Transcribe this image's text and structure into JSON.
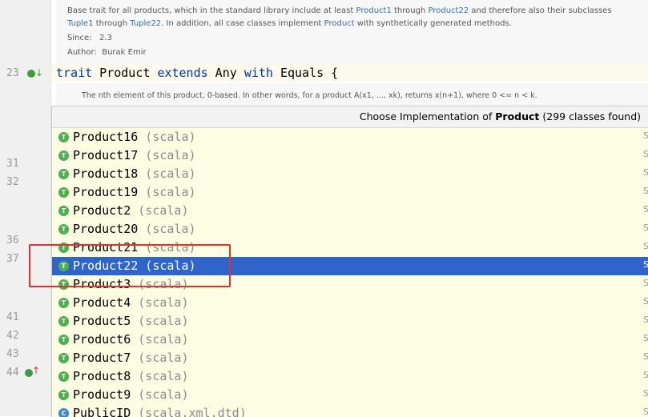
{
  "colors": {
    "accent": "#2f65ca",
    "highlight": "#e8302a",
    "trait_icon": "#4caf50",
    "class_icon": "#3d88d6"
  },
  "doc_top": {
    "line1_a": "Base trait for all products, which in the standard library include at least ",
    "line1_code1": "Product1",
    "line1_b": " through ",
    "line1_code2": "Product22",
    "line1_c": " and therefore also their subclasses",
    "line2_code1": "Tuple1",
    "line2_b": " through ",
    "line2_code2": "Tuple22",
    "line2_c": ". In addition, all case classes implement ",
    "line2_code3": "Product",
    "line2_d": " with synthetically generated methods.",
    "since_label": "Since:",
    "since_value": "2.3",
    "author_label": "Author:",
    "author_value": "Burak Emir"
  },
  "code": {
    "line_number": "23",
    "kw_trait": "trait",
    "name": " Product ",
    "kw_extends": "extends",
    "any": " Any ",
    "kw_with": "with",
    "equals": " Equals {"
  },
  "doc_mid": {
    "text": "The nth element of this product, 0-based. In other words, for a product A(x1, ..., xk), returns x(n+1), where 0 <= n < k."
  },
  "gutter_lines": [
    "31",
    "32",
    "36",
    "37",
    "41",
    "42",
    "43",
    "44"
  ],
  "popup": {
    "title_prefix": "Choose Implementation of ",
    "title_bold": "Product",
    "title_suffix": " (299 classes found)",
    "items": [
      {
        "icon": "T",
        "name": "Product16",
        "pkg": " (scala)"
      },
      {
        "icon": "T",
        "name": "Product17",
        "pkg": " (scala)"
      },
      {
        "icon": "T",
        "name": "Product18",
        "pkg": " (scala)"
      },
      {
        "icon": "T",
        "name": "Product19",
        "pkg": " (scala)"
      },
      {
        "icon": "T",
        "name": "Product2",
        "pkg": " (scala)"
      },
      {
        "icon": "T",
        "name": "Product20",
        "pkg": " (scala)"
      },
      {
        "icon": "T",
        "name": "Product21",
        "pkg": " (scala)"
      },
      {
        "icon": "T",
        "name": "Product22",
        "pkg": " (scala)",
        "selected": true
      },
      {
        "icon": "T",
        "name": "Product3",
        "pkg": " (scala)"
      },
      {
        "icon": "T",
        "name": "Product4",
        "pkg": " (scala)"
      },
      {
        "icon": "T",
        "name": "Product5",
        "pkg": " (scala)"
      },
      {
        "icon": "T",
        "name": "Product6",
        "pkg": " (scala)"
      },
      {
        "icon": "T",
        "name": "Product7",
        "pkg": " (scala)"
      },
      {
        "icon": "T",
        "name": "Product8",
        "pkg": " (scala)"
      },
      {
        "icon": "T",
        "name": "Product9",
        "pkg": " (scala)"
      },
      {
        "icon": "C",
        "name": "PublicID",
        "pkg": " (scala.xml.dtd)"
      }
    ],
    "edge_glyph": "S"
  }
}
